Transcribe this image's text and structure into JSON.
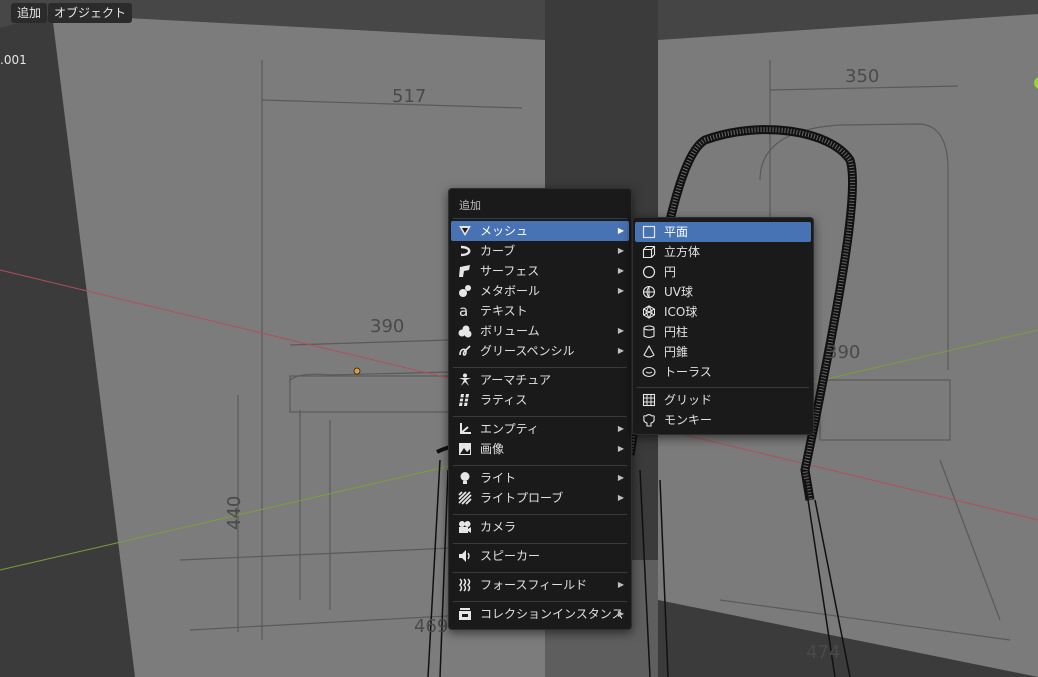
{
  "header": {
    "tabs": [
      {
        "label": ""
      },
      {
        "label": "追加"
      },
      {
        "label": "オブジェクト"
      }
    ]
  },
  "viewport": {
    "object_label": ".001",
    "dimensions_left": [
      "517",
      "390",
      "440",
      "469"
    ],
    "dimensions_right": [
      "350",
      "390",
      "474"
    ]
  },
  "add_menu": {
    "title": "追加",
    "items": [
      {
        "label": "メッシュ",
        "icon": "mesh-icon",
        "submenu": true,
        "selected": true
      },
      {
        "label": "カーブ",
        "icon": "curve-icon",
        "submenu": true
      },
      {
        "label": "サーフェス",
        "icon": "surface-icon",
        "submenu": true
      },
      {
        "label": "メタボール",
        "icon": "metaball-icon",
        "submenu": true
      },
      {
        "label": "テキスト",
        "icon": "text-icon",
        "submenu": false
      },
      {
        "label": "ボリューム",
        "icon": "volume-icon",
        "submenu": true
      },
      {
        "label": "グリースペンシル",
        "icon": "grease-pencil-icon",
        "submenu": true
      },
      {
        "label": "アーマチュア",
        "icon": "armature-icon",
        "submenu": false
      },
      {
        "label": "ラティス",
        "icon": "lattice-icon",
        "submenu": false
      },
      {
        "label": "エンプティ",
        "icon": "empty-icon",
        "submenu": true
      },
      {
        "label": "画像",
        "icon": "image-icon",
        "submenu": true
      },
      {
        "label": "ライト",
        "icon": "light-icon",
        "submenu": true
      },
      {
        "label": "ライトプローブ",
        "icon": "light-probe-icon",
        "submenu": true
      },
      {
        "label": "カメラ",
        "icon": "camera-icon",
        "submenu": false
      },
      {
        "label": "スピーカー",
        "icon": "speaker-icon",
        "submenu": false
      },
      {
        "label": "フォースフィールド",
        "icon": "force-field-icon",
        "submenu": true
      },
      {
        "label": "コレクションインスタンス",
        "icon": "collection-instance-icon",
        "submenu": true
      }
    ]
  },
  "mesh_menu": {
    "items": [
      {
        "label": "平面",
        "icon": "plane-icon",
        "selected": true
      },
      {
        "label": "立方体",
        "icon": "cube-icon"
      },
      {
        "label": "円",
        "icon": "circle-icon"
      },
      {
        "label": "UV球",
        "icon": "uv-sphere-icon"
      },
      {
        "label": "ICO球",
        "icon": "ico-sphere-icon"
      },
      {
        "label": "円柱",
        "icon": "cylinder-icon"
      },
      {
        "label": "円錐",
        "icon": "cone-icon"
      },
      {
        "label": "トーラス",
        "icon": "torus-icon"
      },
      {
        "label": "グリッド",
        "icon": "grid-icon"
      },
      {
        "label": "モンキー",
        "icon": "monkey-icon"
      }
    ]
  },
  "colors": {
    "highlight": "#4772b3",
    "menu_bg": "#1a1a1a",
    "x_axis": "#b0505a",
    "y_axis": "#7aa03a"
  }
}
